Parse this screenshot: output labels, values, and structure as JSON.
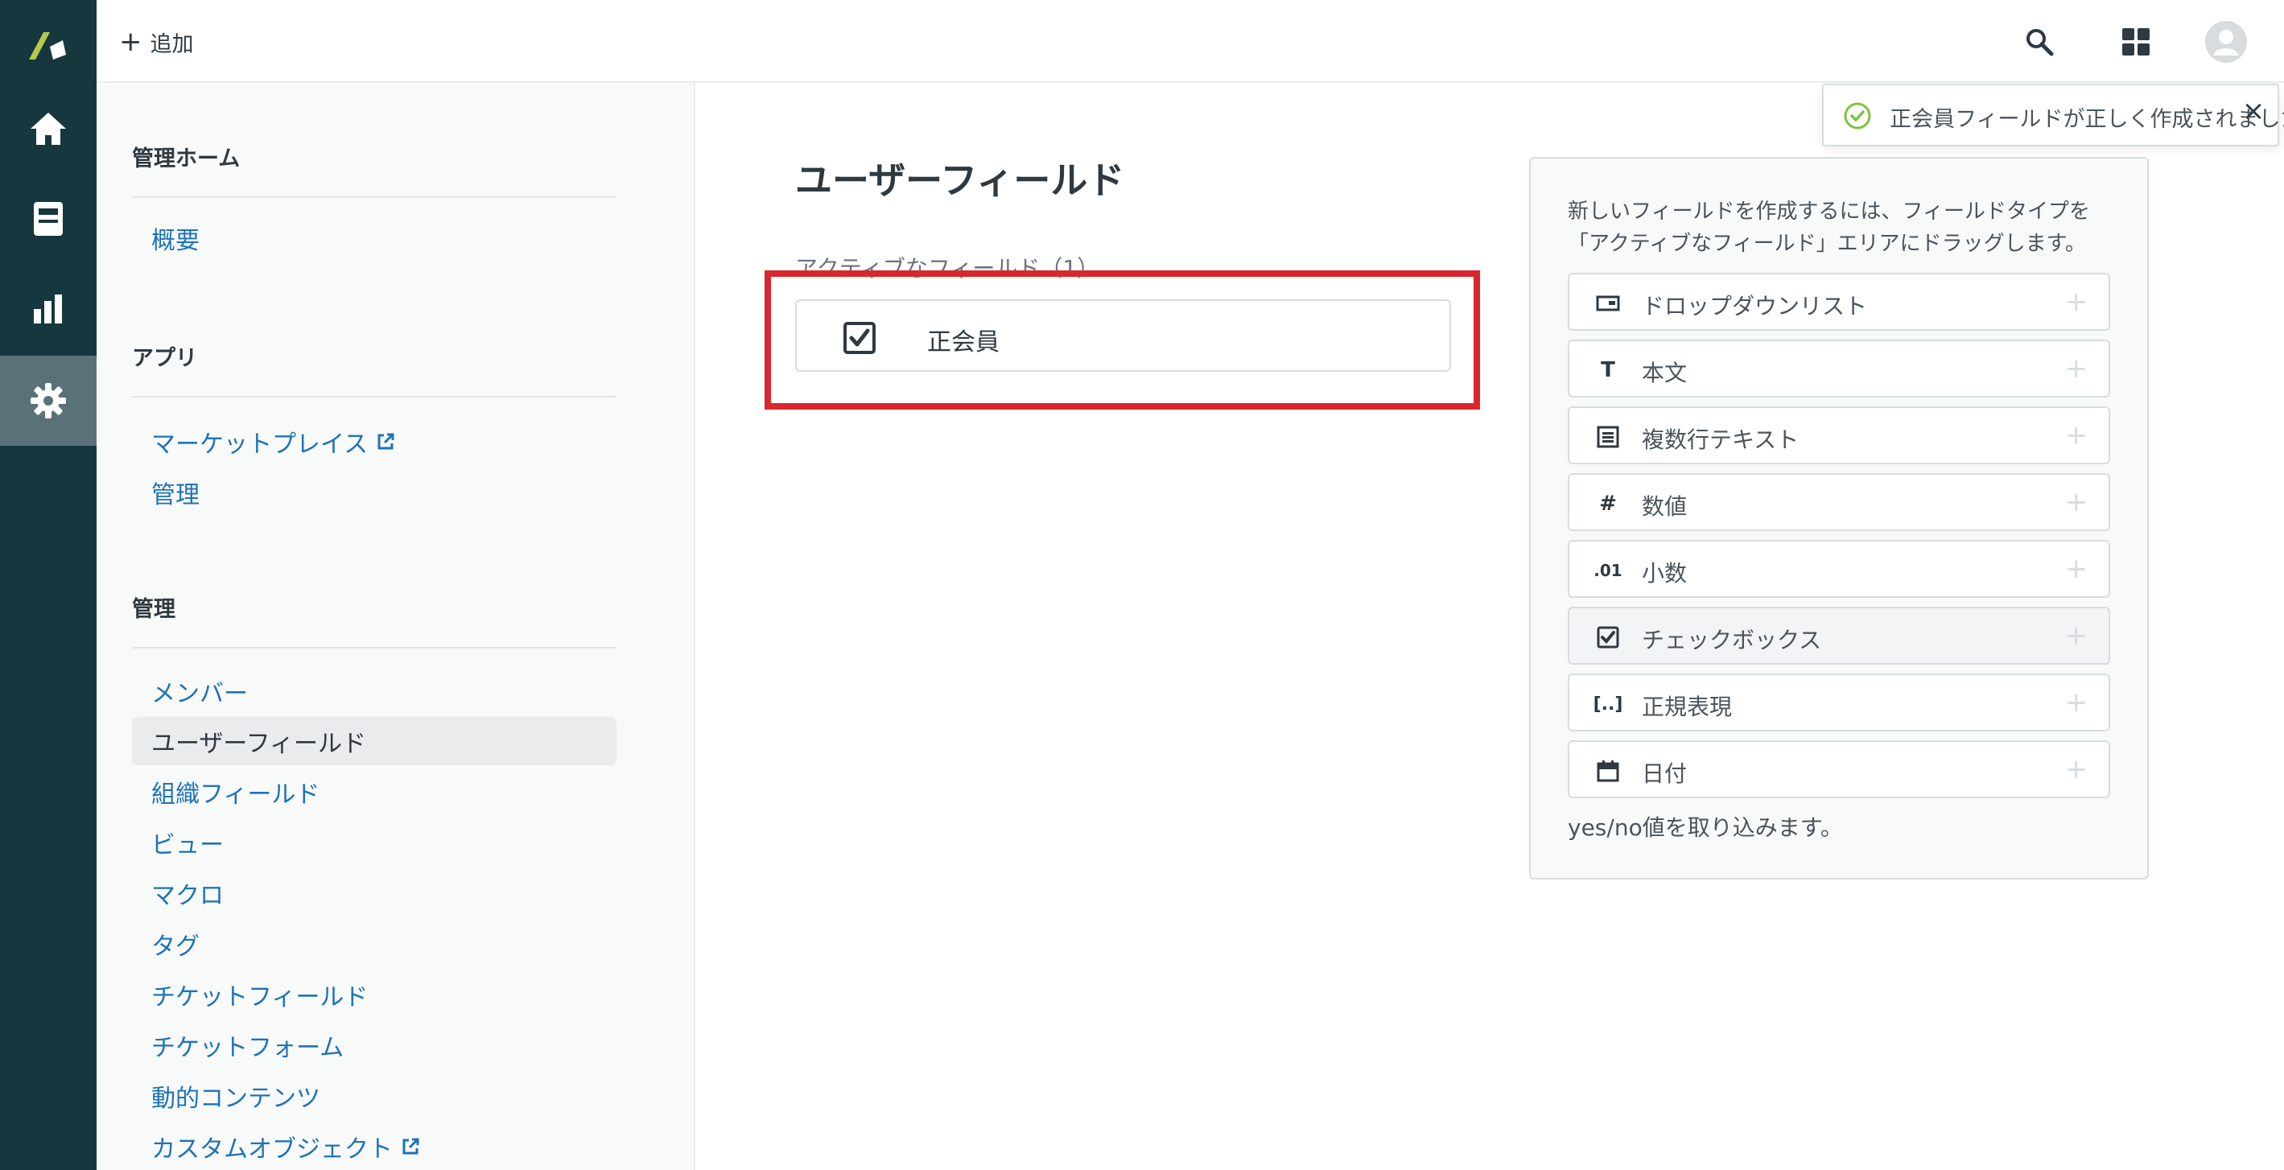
{
  "topbar": {
    "add_label": "追加"
  },
  "subnav": {
    "sections": [
      {
        "heading": "管理ホーム",
        "links": [
          "概要"
        ]
      },
      {
        "heading": "アプリ",
        "links": [
          "マーケットプレイス",
          "管理"
        ]
      },
      {
        "heading": "管理",
        "links": [
          "メンバー",
          "ユーザーフィールド",
          "組織フィールド",
          "ビュー",
          "マクロ",
          "タグ",
          "チケットフィールド",
          "チケットフォーム",
          "動的コンテンツ",
          "カスタムオブジェクト"
        ]
      }
    ],
    "selected": "ユーザーフィールド"
  },
  "main": {
    "title": "ユーザーフィールド",
    "active_fields_label": "アクティブなフィールド（1）",
    "active_fields": [
      {
        "type_icon": "checkbox-icon",
        "name": "正会員"
      }
    ]
  },
  "field_types": {
    "description": "新しいフィールドを作成するには、フィールドタイプを「アクティブなフィールド」エリアにドラッグします。",
    "items": [
      {
        "icon": "dropdown-icon",
        "glyph": "▭",
        "label": "ドロップダウンリスト"
      },
      {
        "icon": "text-icon",
        "glyph": "T",
        "label": "本文"
      },
      {
        "icon": "multiline-icon",
        "glyph": "≣",
        "label": "複数行テキスト"
      },
      {
        "icon": "number-icon",
        "glyph": "#",
        "label": "数値"
      },
      {
        "icon": "decimal-icon",
        "glyph": ".01",
        "label": "小数"
      },
      {
        "icon": "checkbox-icon",
        "glyph": "☑",
        "label": "チェックボックス"
      },
      {
        "icon": "regex-icon",
        "glyph": "[..]",
        "label": "正規表現"
      },
      {
        "icon": "date-icon",
        "glyph": "▦",
        "label": "日付"
      }
    ],
    "hint": "yes/no値を取り込みます。"
  },
  "toast": {
    "message": "正会員フィールドが正しく作成されました",
    "close": "×"
  },
  "colors": {
    "rail": "#17373f",
    "rail_active": "#5a7178",
    "link": "#1f73b7",
    "highlight": "#d8282d",
    "success": "#7fc142"
  }
}
